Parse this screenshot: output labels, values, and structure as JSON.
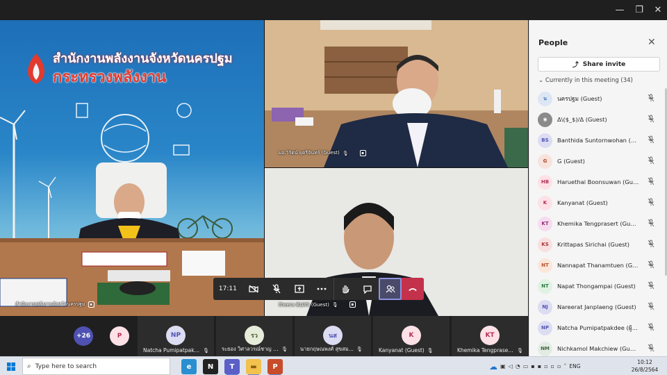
{
  "window": {
    "minimize": "—",
    "restore": "❐",
    "close": "✕"
  },
  "tiles": {
    "left": {
      "label": "สำนักงานพลังงานจังหวัดนครปฐม",
      "banner_line1": "สำนักงานพลังงานจังหวัดนครปฐม",
      "banner_line2": "กระทรวงพลังงาน"
    },
    "top_right": {
      "label": "ผอ.วิรัตน์ ยุตรีจันทร์ (Guest)"
    },
    "bottom_right": {
      "label": "theera BLWS (Guest)"
    }
  },
  "controls": {
    "timer": "17:11",
    "camera_icon": "camera-off-icon",
    "mic_icon": "mic-off-icon",
    "share_icon": "share-screen-icon",
    "more_icon": "more-icon",
    "raise_hand_icon": "raise-hand-icon",
    "chat_icon": "chat-icon",
    "people_icon": "people-icon",
    "hangup_icon": "hang-up-icon"
  },
  "strip": {
    "overflow_count": "+26",
    "p_badge": "P",
    "tiles": [
      {
        "initials": "NP",
        "name": "Natcha Pumipatpakd...",
        "color": "#dcdcf2",
        "text": "#4f52b2"
      },
      {
        "initials": "รว",
        "name": "ระยอง วิศาลวรณ์ชาญ (G...",
        "color": "#e6ecd9",
        "text": "#4a5a2a"
      },
      {
        "initials": "นส",
        "name": "นายกฤษณพงศ์ สุขสม...",
        "color": "#dcdcf2",
        "text": "#4f52b2"
      },
      {
        "initials": "K",
        "name": "Kanyanat (Guest)",
        "color": "#fde1e7",
        "text": "#b42e56"
      },
      {
        "initials": "KT",
        "name": "Khemika Tengprasert...",
        "color": "#fde1e7",
        "text": "#b42e56"
      }
    ]
  },
  "people": {
    "title": "People",
    "share_invite": "Share invite",
    "heading": "Currently in this meeting (34)",
    "participants": [
      {
        "initials": "น",
        "name": "นครปฐม (Guest)",
        "bg": "#dce6f5",
        "fg": "#3a6ab0"
      },
      {
        "initials": "",
        "name": "Δ\\($_$)/Δ (Guest)",
        "bg": "#8a8a8a",
        "fg": "#ffffff"
      },
      {
        "initials": "BS",
        "name": "Banthida Suntornwohan (Gu...",
        "bg": "#dcdcf2",
        "fg": "#4f52b2"
      },
      {
        "initials": "G",
        "name": "G (Guest)",
        "bg": "#f8e3dc",
        "fg": "#a8452a"
      },
      {
        "initials": "HB",
        "name": "Haruethai Boonsuwan (Guest)",
        "bg": "#fde1e7",
        "fg": "#b42e56"
      },
      {
        "initials": "K",
        "name": "Kanyanat (Guest)",
        "bg": "#fde1e7",
        "fg": "#b42e56"
      },
      {
        "initials": "KT",
        "name": "Khemika Tengprasert (Guest)",
        "bg": "#f5dcee",
        "fg": "#9a2a7a"
      },
      {
        "initials": "KS",
        "name": "Krittapas Sirichai (Guest)",
        "bg": "#f8e0e0",
        "fg": "#a83232"
      },
      {
        "initials": "NT",
        "name": "Nannapat Thanamtuen (Gue...",
        "bg": "#fce6da",
        "fg": "#b4542a"
      },
      {
        "initials": "NT",
        "name": "Napat Thongampai (Guest)",
        "bg": "#dff2e3",
        "fg": "#2a7a3e"
      },
      {
        "initials": "NJ",
        "name": "Nareerat Janplaeng (Guest)",
        "bg": "#dcdcf2",
        "fg": "#4f52b2"
      },
      {
        "initials": "NP",
        "name": "Natcha Pumipatpakdee (ผู้เยี่...",
        "bg": "#dcdcf2",
        "fg": "#4f52b2"
      },
      {
        "initials": "NM",
        "name": "Nichkamol Makchiew (Guest)",
        "bg": "#e3ece3",
        "fg": "#3e6a3e"
      }
    ]
  },
  "taskbar": {
    "search_placeholder": "Type here to search",
    "apps": [
      {
        "name": "edge",
        "glyph": "e",
        "bg": "#2a8fd0",
        "fg": "#ffffff"
      },
      {
        "name": "notion",
        "glyph": "N",
        "bg": "#222222",
        "fg": "#ffffff"
      },
      {
        "name": "teams",
        "glyph": "T",
        "bg": "#5b5fc7",
        "fg": "#ffffff"
      },
      {
        "name": "explorer",
        "glyph": "▬",
        "bg": "#f2c14e",
        "fg": "#8a6010"
      },
      {
        "name": "powerpoint",
        "glyph": "P",
        "bg": "#c84b2a",
        "fg": "#ffffff"
      }
    ],
    "lang": "ENG",
    "time": "10:12",
    "date": "26/8/2564"
  }
}
